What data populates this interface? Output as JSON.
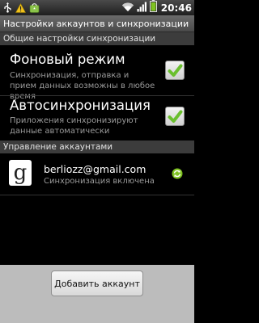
{
  "status_bar": {
    "time": "20:46",
    "icons": [
      "usb-icon",
      "warning-icon",
      "market-icon",
      "wifi-icon",
      "signal-icon",
      "battery-icon"
    ]
  },
  "title": "Настройки аккаунтов и синхронизации",
  "general_section": {
    "header": "Общие настройки синхронизации",
    "background_data": {
      "title": "Фоновый режим",
      "summary": "Синхронизация, отправка и прием данных возможны в любое время",
      "checked": true
    },
    "auto_sync": {
      "title": "Автосинхронизация",
      "summary": "Приложения синхронизируют данные автоматически",
      "checked": true
    }
  },
  "accounts_section": {
    "header": "Управление аккаунтами",
    "accounts": [
      {
        "icon": "google-icon",
        "avatar_letter": "g",
        "email": "berliozz@gmail.com",
        "status": "Синхронизация включена"
      }
    ]
  },
  "add_account_label": "Добавить аккаунт",
  "colors": {
    "check_green": "#6abf2e",
    "sync_green": "#7fc221"
  }
}
